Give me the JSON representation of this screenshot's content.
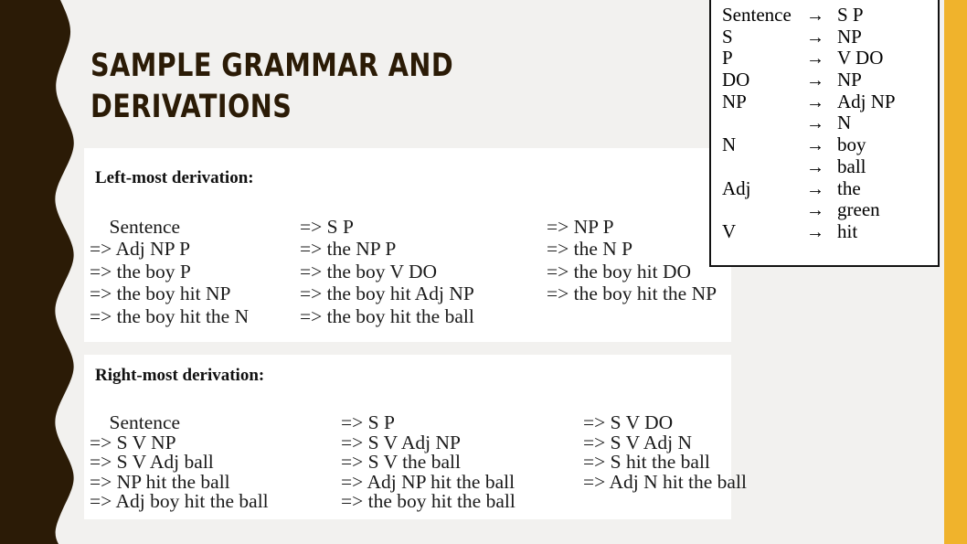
{
  "slide": {
    "title": "SAMPLE GRAMMAR AND\nDERIVATIONS",
    "background_color": "#F2F1EF",
    "accent_brown": "#2B1B06",
    "accent_orange": "#F0B32C",
    "panel_color": "#FFFFFF"
  },
  "grammar_box": {
    "rules": [
      {
        "lhs": "Sentence",
        "arrow": "→",
        "rhs": "S P"
      },
      {
        "lhs": "S",
        "arrow": "→",
        "rhs": "NP"
      },
      {
        "lhs": "P",
        "arrow": "→",
        "rhs": "V DO"
      },
      {
        "lhs": "DO",
        "arrow": "→",
        "rhs": "NP"
      },
      {
        "lhs": "NP",
        "arrow": "→",
        "rhs": "Adj NP"
      },
      {
        "lhs": "",
        "arrow": "→",
        "rhs": "N"
      },
      {
        "lhs": "N",
        "arrow": "→",
        "rhs": "boy"
      },
      {
        "lhs": "",
        "arrow": "→",
        "rhs": "ball"
      },
      {
        "lhs": "Adj",
        "arrow": "→",
        "rhs": "the"
      },
      {
        "lhs": "",
        "arrow": "→",
        "rhs": "green"
      },
      {
        "lhs": "V",
        "arrow": "→",
        "rhs": "hit"
      }
    ]
  },
  "leftmost": {
    "heading": "Left-most derivation:",
    "col1": [
      "    Sentence",
      "=> Adj NP P",
      "=> the boy P",
      "=> the boy hit NP",
      "=> the boy hit the N"
    ],
    "col2": [
      "=> S P",
      "=> the NP P",
      "=> the boy V DO",
      "=> the boy hit Adj NP",
      "=> the boy hit the ball"
    ],
    "col3": [
      "=> NP P",
      "=> the N P",
      "=> the boy hit DO",
      "=> the boy hit the NP",
      ""
    ]
  },
  "rightmost": {
    "heading": "Right-most derivation:",
    "col1": [
      "    Sentence",
      "=> S V NP",
      "=> S V Adj ball",
      "=> NP hit the ball",
      "=> Adj boy hit the ball"
    ],
    "col2": [
      "=> S P",
      "=> S V Adj NP",
      "=> S V the ball",
      "=> Adj NP hit the ball",
      "=> the boy hit the ball"
    ],
    "col3": [
      "=> S V DO",
      "=> S V Adj N",
      "=> S hit the ball",
      "=> Adj N hit the ball",
      ""
    ]
  }
}
